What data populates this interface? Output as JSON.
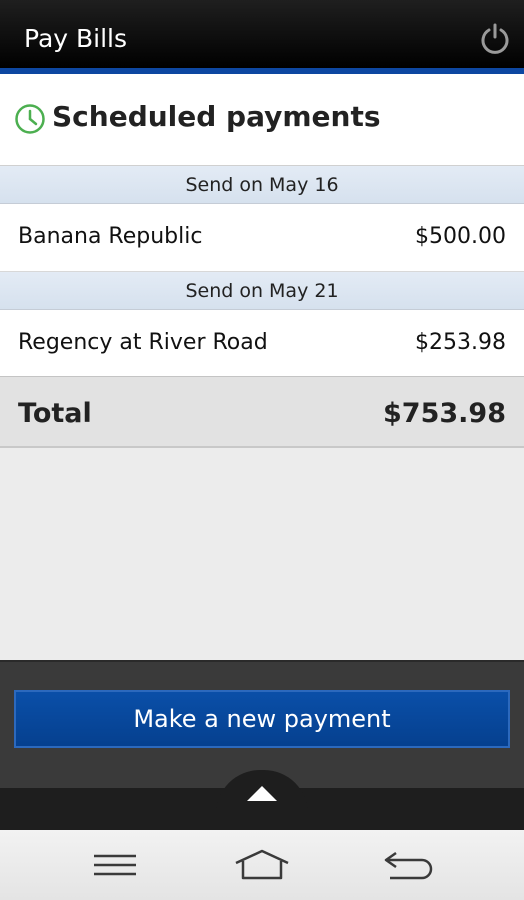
{
  "app": {
    "title": "Pay Bills"
  },
  "header": {
    "title": "Scheduled payments"
  },
  "payments": [
    {
      "send_date": "Send on May 16",
      "payee": "Banana Republic",
      "amount": "$500.00"
    },
    {
      "send_date": "Send on May 21",
      "payee": "Regency at River Road",
      "amount": "$253.98"
    }
  ],
  "total": {
    "label": "Total",
    "amount": "$753.98"
  },
  "actions": {
    "new_payment_label": "Make a new payment"
  },
  "icons": {
    "power": "power-icon",
    "clock": "clock-icon",
    "drawer": "chevron-up-icon",
    "menu": "menu-icon",
    "home": "home-icon",
    "back": "back-icon"
  },
  "colors": {
    "accent": "#0d47a1",
    "clock": "#4caf50",
    "button": "#0a4fa8"
  }
}
